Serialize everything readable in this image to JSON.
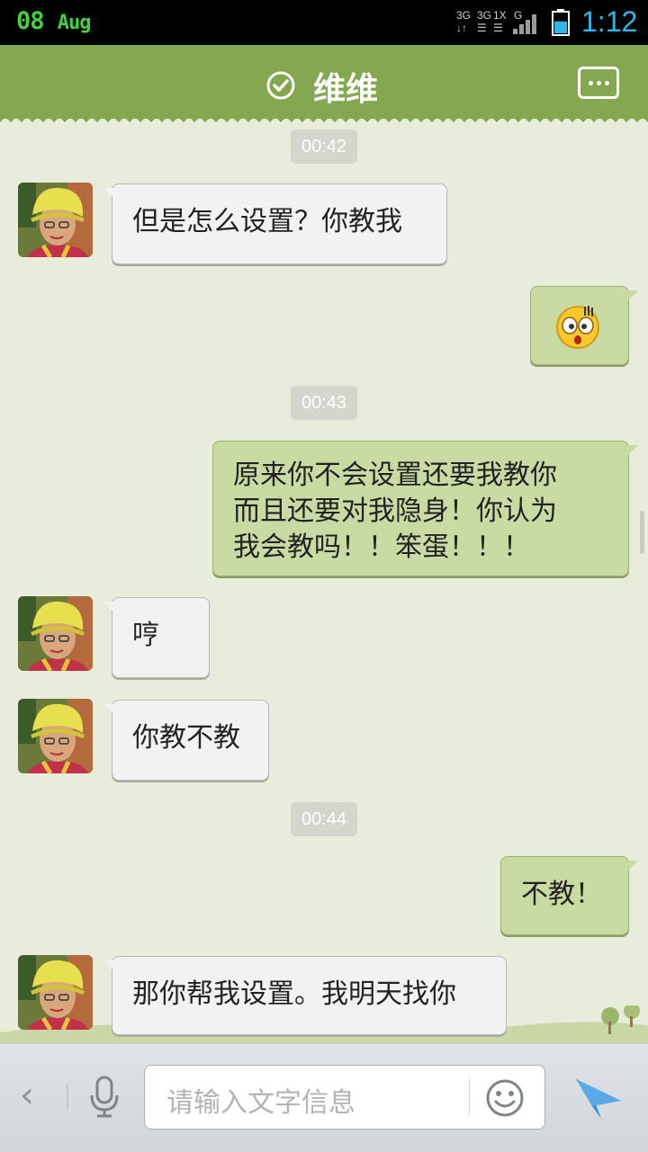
{
  "status_bar": {
    "date_day": "08",
    "date_month": "Aug",
    "sig1": "3G",
    "sig2": "3G",
    "sig3": "1X",
    "sig4": "G",
    "time": "1:12",
    "battery_level": 0.55
  },
  "header": {
    "title": "维维",
    "status_icon": "check-circle-icon",
    "menu_icon": "more-dots-icon"
  },
  "messages": [
    {
      "type": "time",
      "text": "00:42"
    },
    {
      "type": "in",
      "text": "但是怎么设置？你教我"
    },
    {
      "type": "out",
      "emoji": "shocked-face-emoji"
    },
    {
      "type": "time",
      "text": "00:43"
    },
    {
      "type": "out",
      "lines": [
        "原来你不会设置还要我教你",
        "而且还要对我隐身！你认为",
        "我会教吗！！笨蛋！！！"
      ]
    },
    {
      "type": "in",
      "text": "哼"
    },
    {
      "type": "in",
      "text": "你教不教"
    },
    {
      "type": "time",
      "text": "00:44"
    },
    {
      "type": "out",
      "text": "不教！"
    },
    {
      "type": "in",
      "text": "那你帮我设置。我明天找你"
    }
  ],
  "input_bar": {
    "placeholder": "请输入文字信息",
    "back_icon": "chevron-left-icon",
    "voice_icon": "microphone-icon",
    "emoji_icon": "smiley-icon",
    "send_icon": "send-arrow-icon"
  },
  "colors": {
    "header": "#83a850",
    "background": "#e8eddb",
    "bubble_out": "#c8dba3",
    "bubble_in": "#f2f2f2",
    "time_accent": "#31b6e7"
  }
}
